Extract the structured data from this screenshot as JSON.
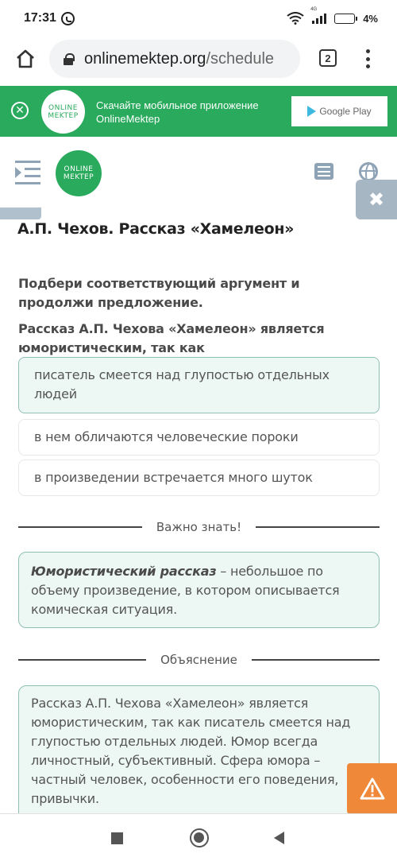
{
  "status_bar": {
    "time": "17:31",
    "network_label": "4G",
    "battery": "4%"
  },
  "browser": {
    "url_domain": "onlinemektep.org",
    "url_path": "/schedule",
    "tab_count": "2"
  },
  "app_banner": {
    "logo_line1": "ONLINE",
    "logo_line2": "MEKTEP",
    "text_line1": "Скачайте мобильное приложение",
    "text_line2": "OnlineMektep",
    "store_button": "Google Play"
  },
  "header": {
    "logo_line1": "ONLINE",
    "logo_line2": "MEKTEP"
  },
  "lesson": {
    "title": "А.П. Чехов. Рассказ «Хамелеон»",
    "instruction": "Подбери соответствующий аргумент и продолжи предложение.",
    "statement": "Рассказ А.П. Чехова «Хамелеон» является юмористическим, так как",
    "options": [
      {
        "text": "писатель смеется над глупостью отдельных людей",
        "selected": true
      },
      {
        "text": "в нем обличаются человеческие пороки",
        "selected": false
      },
      {
        "text": "в произведении встречается много шуток",
        "selected": false
      }
    ],
    "important": {
      "heading": "Важно знать!",
      "term": "Юмористический рассказ",
      "definition": " – небольшое по объему произведение, в котором описывается комическая ситуация."
    },
    "explanation": {
      "heading": "Объяснение",
      "text": "Рассказ А.П. Чехова «Хамелеон» является юмористическим, так как писатель смеется над глупостью отдельных людей. Юмор всегда личностный, субъективный. Сфера юмора – частный человек, особенности его поведения, привычки."
    }
  },
  "colors": {
    "brand_green": "#2aaa5c",
    "selected_bg": "#edf8f5",
    "selected_border": "#8fbfb5",
    "report_orange": "#f0883a",
    "icon_gray": "#8ea3b6"
  }
}
